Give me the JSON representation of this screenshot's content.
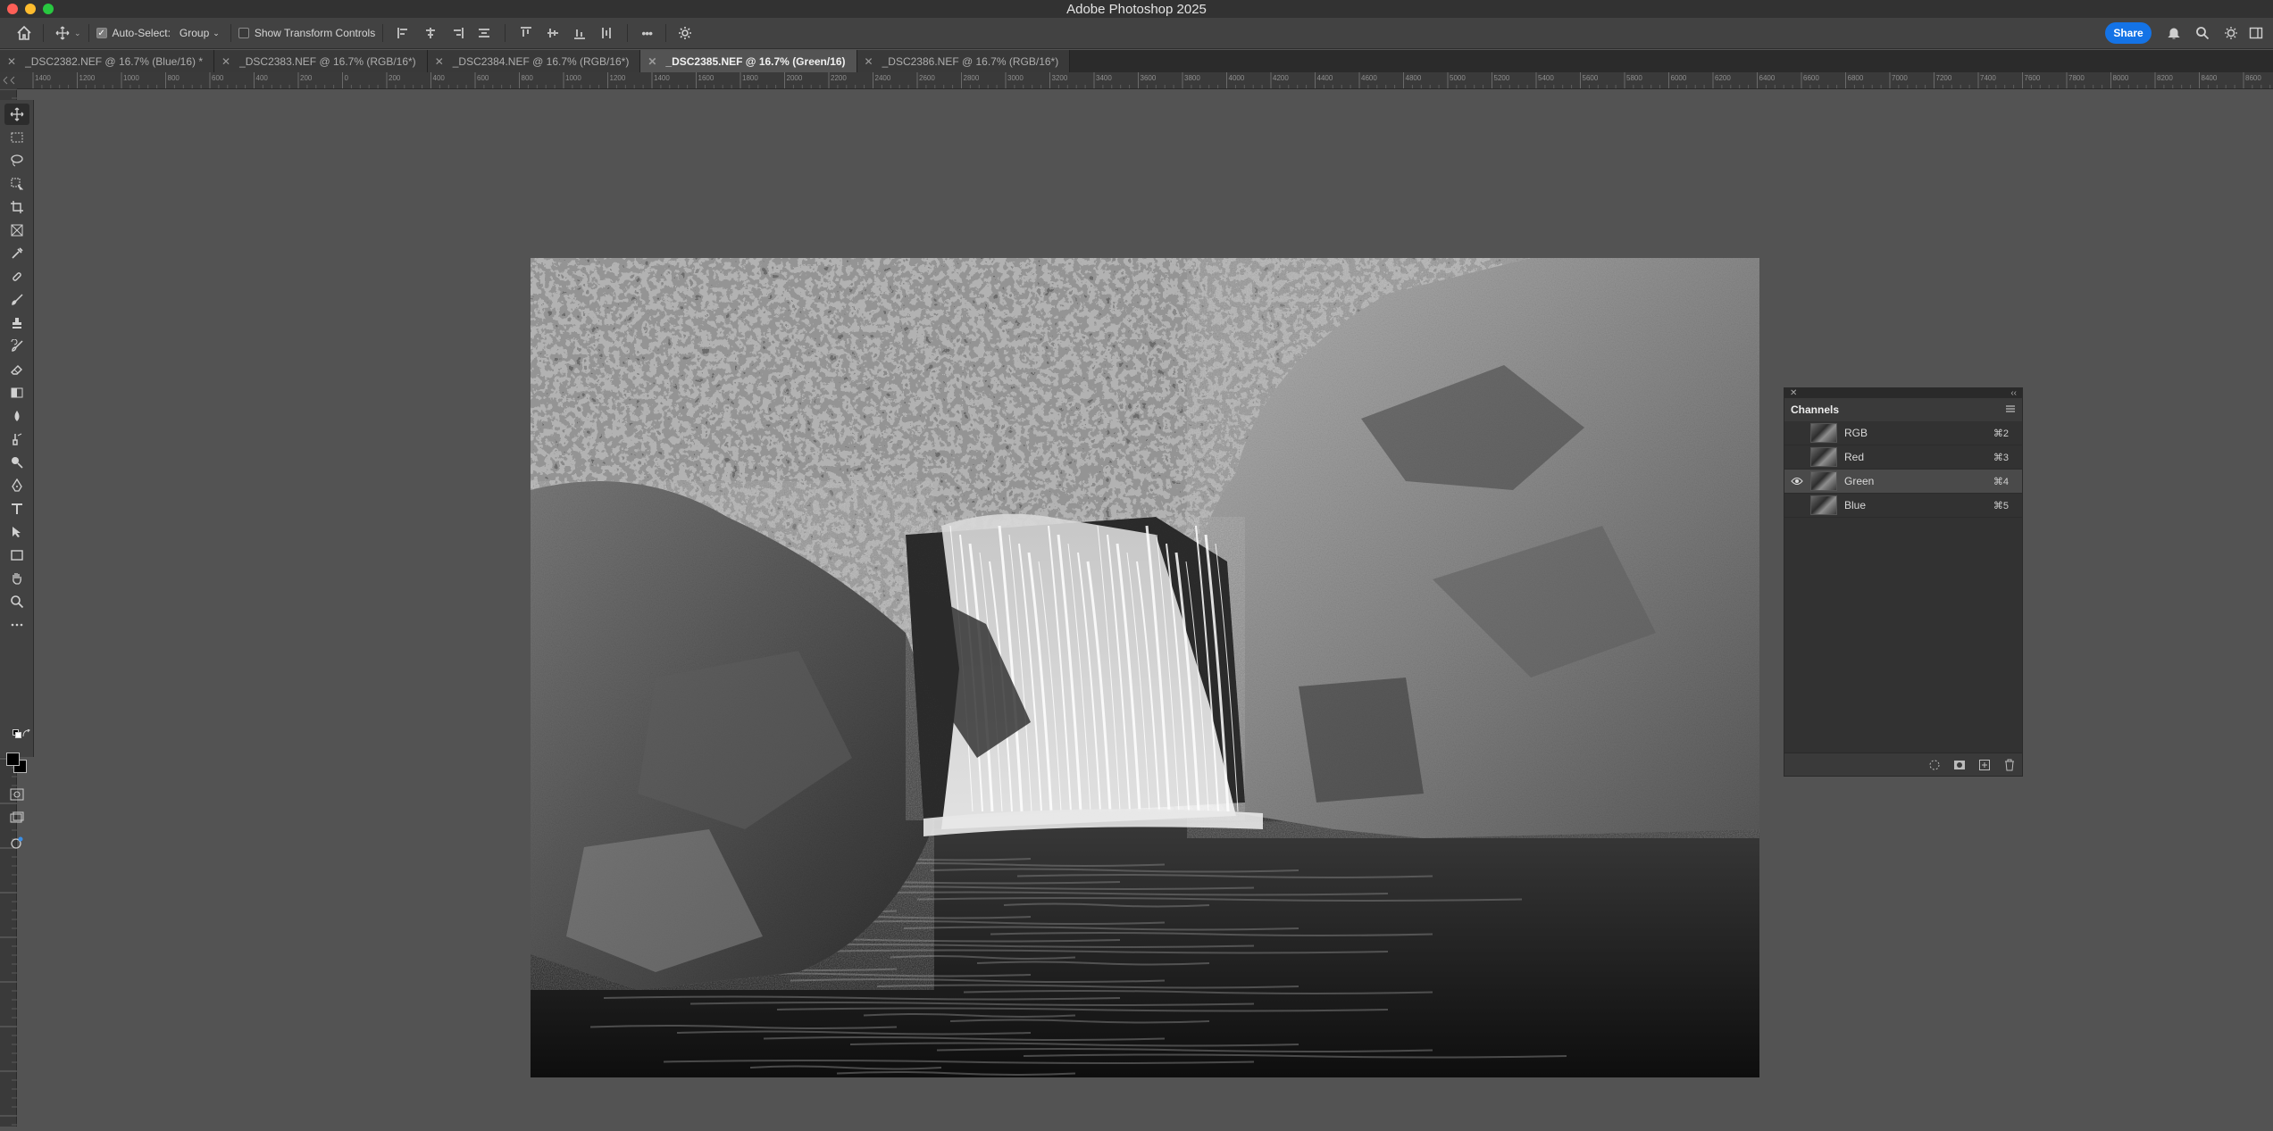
{
  "app": {
    "title": "Adobe Photoshop 2025"
  },
  "options_bar": {
    "auto_select_label": "Auto-Select:",
    "auto_select_checked": true,
    "auto_select_value": "Group",
    "show_transform_label": "Show Transform Controls",
    "show_transform_checked": false,
    "more_label": "•••",
    "share_label": "Share"
  },
  "tabs": [
    {
      "label": "_DSC2382.NEF @ 16.7% (Blue/16) *",
      "active": false
    },
    {
      "label": "_DSC2383.NEF @ 16.7% (RGB/16*)",
      "active": false
    },
    {
      "label": "_DSC2384.NEF @ 16.7% (RGB/16*)",
      "active": false
    },
    {
      "label": "_DSC2385.NEF @ 16.7% (Green/16)",
      "active": true
    },
    {
      "label": "_DSC2386.NEF @ 16.7% (RGB/16*)",
      "active": false
    }
  ],
  "ruler_top_labels": [
    "1400",
    "1200",
    "1000",
    "800",
    "600",
    "400",
    "200",
    "0",
    "200",
    "400",
    "600",
    "800",
    "1000",
    "1200",
    "1400",
    "1600",
    "1800",
    "2000",
    "2200",
    "2400",
    "2600",
    "2800",
    "3000",
    "3200",
    "3400",
    "3600",
    "3800",
    "4000",
    "4200",
    "4400",
    "4600",
    "4800",
    "5000",
    "5200",
    "5400",
    "5600",
    "5800",
    "6000",
    "6200",
    "6400",
    "6600",
    "6800",
    "7000",
    "7200",
    "7400",
    "7600",
    "7800",
    "8000",
    "8200",
    "8400",
    "8600"
  ],
  "tools": [
    "move-tool-icon",
    "rectangular-marquee-icon",
    "lasso-icon",
    "object-selection-icon",
    "crop-icon",
    "frame-icon",
    "eyedropper-icon",
    "healing-brush-icon",
    "brush-icon",
    "clone-stamp-icon",
    "history-brush-icon",
    "eraser-icon",
    "gradient-icon",
    "blur-icon",
    "smudge-icon",
    "dodge-icon",
    "pen-icon",
    "type-icon",
    "path-selection-icon",
    "rectangle-icon",
    "hand-icon",
    "zoom-icon",
    "more-tools-icon"
  ],
  "channels_panel": {
    "title": "Channels",
    "channels": [
      {
        "name": "RGB",
        "shortcut": "⌘2",
        "visible": false,
        "selected": false
      },
      {
        "name": "Red",
        "shortcut": "⌘3",
        "visible": false,
        "selected": false
      },
      {
        "name": "Green",
        "shortcut": "⌘4",
        "visible": true,
        "selected": true
      },
      {
        "name": "Blue",
        "shortcut": "⌘5",
        "visible": false,
        "selected": false
      }
    ]
  }
}
